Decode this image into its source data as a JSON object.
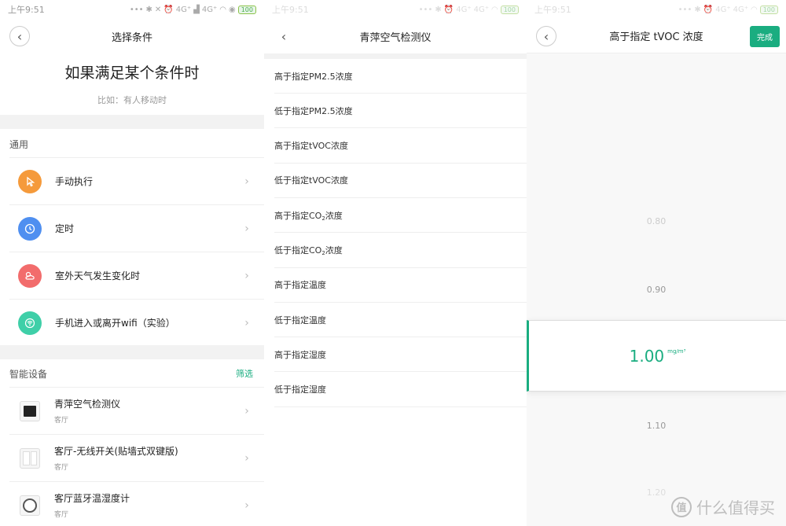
{
  "status": {
    "time": "上午9:51",
    "net1": "4G⁺",
    "net2": "4G⁺",
    "battery": "100"
  },
  "panel1": {
    "title": "选择条件",
    "hero_title": "如果满足某个条件时",
    "hero_sub": "比如：有人移动时",
    "general_header": "通用",
    "general_items": [
      {
        "label": "手动执行",
        "icon": "hand-pointer-icon",
        "color": "#f59a3b"
      },
      {
        "label": "定时",
        "icon": "clock-icon",
        "color": "#4f8ff0"
      },
      {
        "label": "室外天气发生变化时",
        "icon": "weather-icon",
        "color": "#f26c6c"
      },
      {
        "label": "手机进入或离开wifi（实验）",
        "icon": "wifi-icon",
        "color": "#3fcfa8"
      }
    ],
    "devices_header": "智能设备",
    "filter_label": "筛选",
    "devices": [
      {
        "name": "青萍空气检测仪",
        "room": "客厅"
      },
      {
        "name": "客厅-无线开关(贴墙式双键版)",
        "room": "客厅"
      },
      {
        "name": "客厅蓝牙温湿度计",
        "room": "客厅"
      }
    ]
  },
  "panel2": {
    "title": "青萍空气检测仪",
    "options": [
      {
        "pre": "高于指定PM2.5浓度",
        "sub": "",
        "post": ""
      },
      {
        "pre": "低于指定PM2.5浓度",
        "sub": "",
        "post": ""
      },
      {
        "pre": "高于指定tVOC浓度",
        "sub": "",
        "post": ""
      },
      {
        "pre": "低于指定tVOC浓度",
        "sub": "",
        "post": ""
      },
      {
        "pre": "高于指定CO",
        "sub": "2",
        "post": "浓度"
      },
      {
        "pre": "低于指定CO",
        "sub": "2",
        "post": "浓度"
      },
      {
        "pre": "高于指定温度",
        "sub": "",
        "post": ""
      },
      {
        "pre": "低于指定温度",
        "sub": "",
        "post": ""
      },
      {
        "pre": "高于指定湿度",
        "sub": "",
        "post": ""
      },
      {
        "pre": "低于指定湿度",
        "sub": "",
        "post": ""
      }
    ]
  },
  "panel3": {
    "title": "高于指定 tVOC 浓度",
    "done_label": "完成",
    "values_above": [
      "0.80",
      "0.90"
    ],
    "selected_value": "1.00",
    "unit": "mg/m³",
    "values_below": [
      "1.10",
      "1.20"
    ],
    "watermark_badge": "值",
    "watermark_text": "什么值得买"
  }
}
